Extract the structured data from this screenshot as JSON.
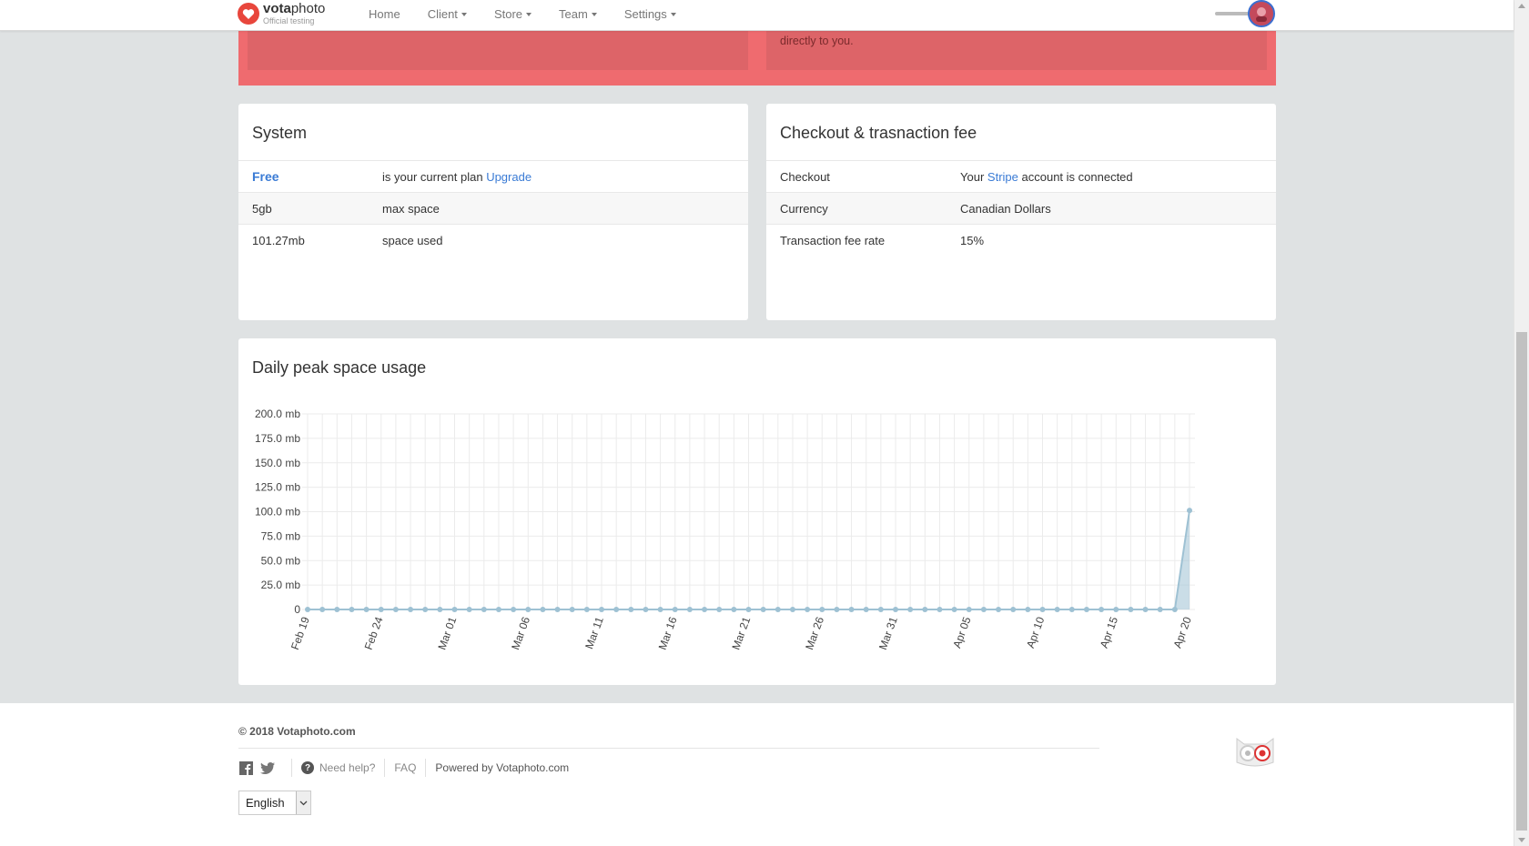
{
  "brand": {
    "name_bold": "vota",
    "name_light": "photo",
    "subtitle": "Official testing"
  },
  "nav": {
    "items": [
      {
        "label": "Home",
        "dropdown": false
      },
      {
        "label": "Client",
        "dropdown": true
      },
      {
        "label": "Store",
        "dropdown": true
      },
      {
        "label": "Team",
        "dropdown": true
      },
      {
        "label": "Settings",
        "dropdown": true
      }
    ]
  },
  "alert": {
    "partial_text": "directly to you."
  },
  "system": {
    "title": "System",
    "plan_name": "Free",
    "plan_text": "is your current plan",
    "upgrade_label": "Upgrade",
    "rows": [
      {
        "value": "5gb",
        "label": "max space"
      },
      {
        "value": "101.27mb",
        "label": "space used"
      }
    ]
  },
  "checkout": {
    "title": "Checkout & trasnaction fee",
    "checkout_label": "Checkout",
    "checkout_prefix": "Your",
    "checkout_link": "Stripe",
    "checkout_suffix": "account is connected",
    "rows": [
      {
        "label": "Currency",
        "value": "Canadian Dollars"
      },
      {
        "label": "Transaction fee rate",
        "value": "15%"
      }
    ]
  },
  "chart_data": {
    "type": "area",
    "title": "Daily peak space usage",
    "y_ticks": [
      "200.0 mb",
      "175.0 mb",
      "150.0 mb",
      "125.0 mb",
      "100.0 mb",
      "75.0 mb",
      "50.0 mb",
      "25.0 mb",
      "0"
    ],
    "ylim": [
      0,
      200
    ],
    "x_tick_labels": [
      "Feb 19",
      "Feb 24",
      "Mar 01",
      "Mar 06",
      "Mar 11",
      "Mar 16",
      "Mar 21",
      "Mar 26",
      "Mar 31",
      "Apr 05",
      "Apr 10",
      "Apr 15",
      "Apr 20"
    ],
    "x_start": "Feb 19",
    "x_end": "Apr 20",
    "series": [
      {
        "values": [
          0,
          0,
          0,
          0,
          0,
          0,
          0,
          0,
          0,
          0,
          0,
          0,
          0,
          0,
          0,
          0,
          0,
          0,
          0,
          0,
          0,
          0,
          0,
          0,
          0,
          0,
          0,
          0,
          0,
          0,
          0,
          0,
          0,
          0,
          0,
          0,
          0,
          0,
          0,
          0,
          0,
          0,
          0,
          0,
          0,
          0,
          0,
          0,
          0,
          0,
          0,
          0,
          0,
          0,
          0,
          0,
          0,
          0,
          0,
          0,
          101.27
        ]
      }
    ],
    "color": "#9ec1d3",
    "grid": true
  },
  "footer": {
    "copyright": "© 2018 Votaphoto.com",
    "need_help": "Need help?",
    "faq": "FAQ",
    "powered_prefix": "Powered by",
    "powered_link": "Votaphoto.com",
    "language": "English"
  }
}
